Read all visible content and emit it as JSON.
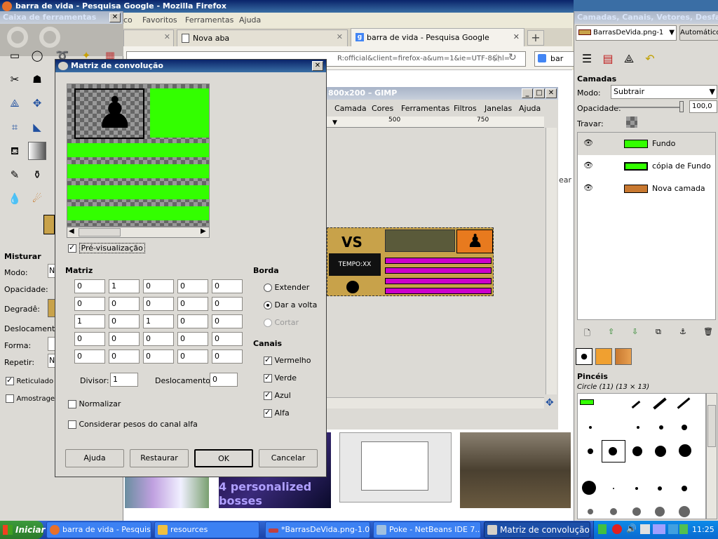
{
  "firefox": {
    "title": "barra de vida - Pesquisa Google - Mozilla Firefox",
    "menu": [
      "co",
      "Favoritos",
      "Ferramentas",
      "Ajuda"
    ],
    "tabs": [
      {
        "label": ""
      },
      {
        "label": "Nova aba"
      },
      {
        "label": "barra de vida - Pesquisa Google"
      }
    ],
    "url": "R:official&client=firefox-a&um=1&ie=UTF-8&hl=",
    "search": "bar",
    "side_text": "ear"
  },
  "toolbox": {
    "title": "Caixa de ferramentas",
    "section": "Misturar",
    "options": [
      {
        "label": "Modo:",
        "value": "N"
      },
      {
        "label": "Opacidade:",
        "value": ""
      },
      {
        "label": "Degradê:",
        "value": ""
      },
      {
        "label": "Deslocamento:",
        "value": ""
      },
      {
        "label": "Forma:",
        "value": ""
      },
      {
        "label": "Repetir:",
        "value": "N"
      }
    ],
    "reticulado": "Reticulado",
    "amostragem": "Amostragem"
  },
  "gimp_image": {
    "title": "800x200 – GIMP",
    "menu": [
      "Camada",
      "Cores",
      "Ferramentas",
      "Filtros",
      "Janelas",
      "Ajuda"
    ],
    "ruler": [
      "500",
      "750"
    ],
    "vs": "VS",
    "tempo": "TEMPO:XX"
  },
  "dialog": {
    "title": "Matriz de convolução",
    "preview_label": "Pré-visualização",
    "matrix_label": "Matriz",
    "matrix": [
      [
        "0",
        "1",
        "0",
        "0",
        "0"
      ],
      [
        "0",
        "0",
        "0",
        "0",
        "0"
      ],
      [
        "1",
        "0",
        "1",
        "0",
        "0"
      ],
      [
        "0",
        "0",
        "0",
        "0",
        "0"
      ],
      [
        "0",
        "0",
        "0",
        "0",
        "0"
      ]
    ],
    "divisor_label": "Divisor:",
    "divisor": "1",
    "offset_label": "Deslocamento:",
    "offset": "0",
    "normalize": "Normalizar",
    "alpha_weights": "Considerar pesos do canal alfa",
    "border_label": "Borda",
    "border_options": [
      "Extender",
      "Dar a volta",
      "Cortar"
    ],
    "channels_label": "Canais",
    "channels": [
      "Vermelho",
      "Verde",
      "Azul",
      "Alfa"
    ],
    "buttons": [
      "Ajuda",
      "Restaurar",
      "OK",
      "Cancelar"
    ]
  },
  "layers": {
    "title": "Camadas, Canais, Vetores, Desfa...",
    "image_select": "BarrasDeVida.png-1",
    "auto": "Automático",
    "section": "Camadas",
    "mode_label": "Modo:",
    "mode": "Subtrair",
    "opacity_label": "Opacidade:",
    "opacity": "100,0",
    "lock_label": "Travar:",
    "list": [
      "Fundo",
      "cópia de Fundo",
      "Nova camada"
    ],
    "brushes_label": "Pincéis",
    "brush_name": "Circle (11) (13 × 13)"
  },
  "thumbs": {
    "text1": "4 personalized",
    "text2": "bosses"
  },
  "taskbar": {
    "start": "Iniciar",
    "items": [
      "barra de vida - Pesquis...",
      "resources",
      "*BarrasDeVida.png-1.0...",
      "Poke - NetBeans IDE 7....",
      "Matriz de convolução"
    ],
    "clock": "11:25"
  },
  "colors": {
    "accent_green": "#33ff00",
    "magenta": "#cc00cc",
    "orange": "#e87a1e",
    "title_blue": "#0a246a"
  }
}
